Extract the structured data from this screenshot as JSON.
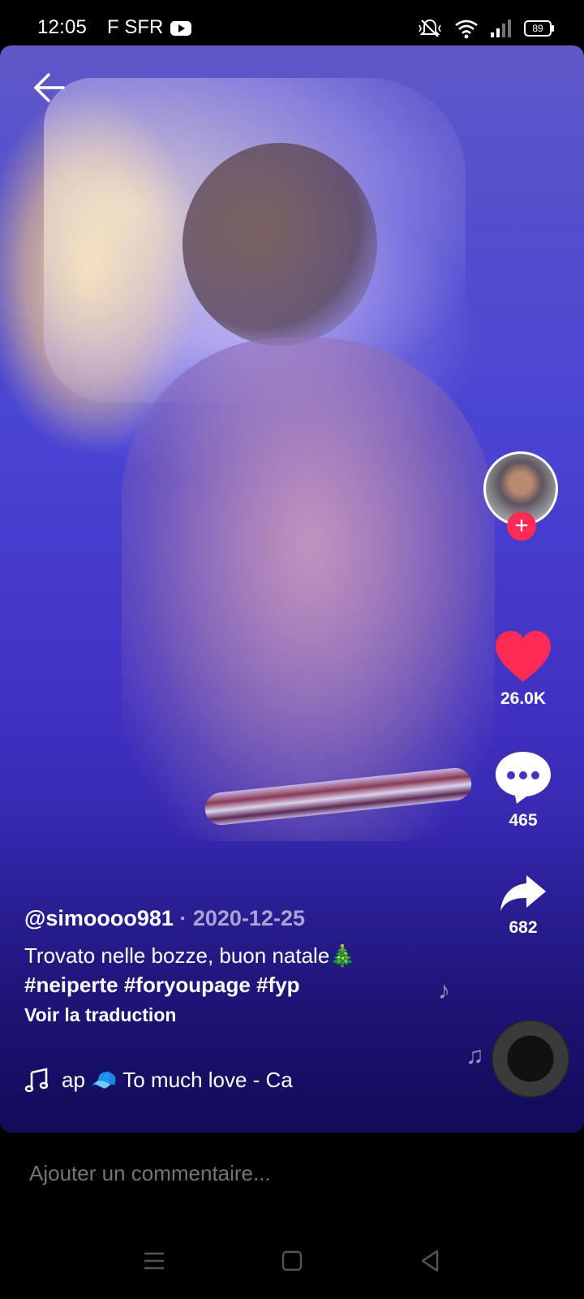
{
  "status_bar": {
    "time": "12:05",
    "carrier": "F SFR",
    "battery": "89",
    "icons": [
      "youtube-icon",
      "mute-icon",
      "wifi-icon",
      "signal-icon",
      "battery-icon"
    ]
  },
  "video": {
    "author": "@simoooo981",
    "date": "2020-12-25",
    "separator": " · ",
    "caption": "Trovato nelle bozze, buon natale🎄",
    "hashtags": "#neiperte #foryoupage #fyp",
    "translate_label": "Voir la traduction",
    "music_text": "ap 🧢    To much love - Ca"
  },
  "actions": {
    "likes": "26.0K",
    "comments": "465",
    "shares": "682"
  },
  "comment_bar": {
    "placeholder": "Ajouter un commentaire..."
  },
  "colors": {
    "like_red": "#fe2c55",
    "follow_red": "#fe2c55",
    "background": "#000000"
  }
}
